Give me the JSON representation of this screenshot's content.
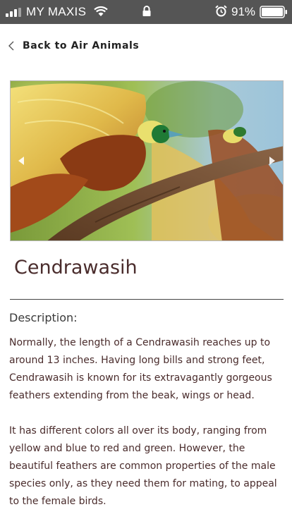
{
  "status_bar": {
    "carrier": "MY MAXIS",
    "battery_percent": "91%",
    "background": "#555555",
    "icons": [
      "signal-bars-icon",
      "wifi-icon",
      "lock-icon",
      "alarm-icon",
      "battery-icon"
    ]
  },
  "nav": {
    "back_label": "Back to Air Animals",
    "back_icon": "chevron-left-icon"
  },
  "carousel": {
    "image_subject": "bird-of-paradise-photo",
    "prev_icon": "triangle-left-icon",
    "next_icon": "triangle-right-icon"
  },
  "animal": {
    "name": "Cendrawasih",
    "description_heading": "Description:",
    "paragraphs": [
      "Normally, the length of a Cendrawasih reaches up to around 13 inches. Having long bills and strong feet, Cendrawasih is known for its extravagantly gorgeous feathers extending from the beak, wings or head.",
      "It has different colors all over its body, ranging from yellow and blue to red and green. However, the beautiful feathers are common properties of the male species only, as they need them for mating, to appeal to the female birds."
    ]
  },
  "colors": {
    "title_text": "#4a2c2c",
    "body_text": "#4a2c2c",
    "divider": "#444444"
  }
}
